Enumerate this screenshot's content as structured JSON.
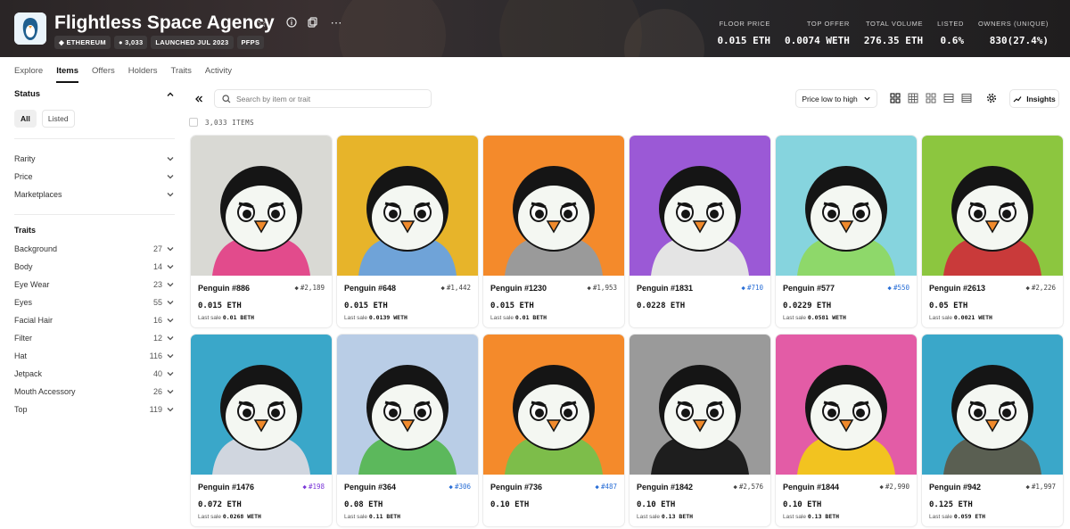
{
  "header": {
    "title": "Flightless Space Agency",
    "chips": [
      "◆ ETHEREUM",
      "● 3,033",
      "LAUNCHED JUL 2023",
      "PFPS"
    ],
    "stats": [
      {
        "label": "FLOOR PRICE",
        "value": "0.015 ETH"
      },
      {
        "label": "TOP OFFER",
        "value": "0.0074 WETH"
      },
      {
        "label": "TOTAL VOLUME",
        "value": "276.35 ETH"
      },
      {
        "label": "LISTED",
        "value": "0.6%"
      },
      {
        "label": "OWNERS (UNIQUE)",
        "value": "830(27.4%)"
      }
    ]
  },
  "tabs": [
    "Explore",
    "Items",
    "Offers",
    "Holders",
    "Traits",
    "Activity"
  ],
  "active_tab": "Items",
  "sidebar": {
    "status_label": "Status",
    "status_options": [
      "All",
      "Listed"
    ],
    "filters": [
      "Rarity",
      "Price",
      "Marketplaces"
    ],
    "traits_label": "Traits",
    "traits": [
      {
        "name": "Background",
        "count": "27"
      },
      {
        "name": "Body",
        "count": "14"
      },
      {
        "name": "Eye Wear",
        "count": "23"
      },
      {
        "name": "Eyes",
        "count": "55"
      },
      {
        "name": "Facial Hair",
        "count": "16"
      },
      {
        "name": "Filter",
        "count": "12"
      },
      {
        "name": "Hat",
        "count": "116"
      },
      {
        "name": "Jetpack",
        "count": "40"
      },
      {
        "name": "Mouth Accessory",
        "count": "26"
      },
      {
        "name": "Top",
        "count": "119"
      }
    ]
  },
  "toolbar": {
    "search_placeholder": "Search by item or trait",
    "sort_label": "Price low to high",
    "insights_label": "Insights"
  },
  "items_count": "3,033 ITEMS",
  "items": [
    {
      "name": "Penguin #886",
      "rank": "#2,189",
      "rank_tier": "gray",
      "price": "0.015 ETH",
      "last_label": "Last sale",
      "last_value": "0.01 BETH",
      "bg": "#d9d9d4",
      "outfit": "#e24b8c"
    },
    {
      "name": "Penguin #648",
      "rank": "#1,442",
      "rank_tier": "gray",
      "price": "0.015 ETH",
      "last_label": "Last sale",
      "last_value": "0.0139 WETH",
      "bg": "#e7b42a",
      "outfit": "#6fa3d8"
    },
    {
      "name": "Penguin #1230",
      "rank": "#1,953",
      "rank_tier": "gray",
      "price": "0.015 ETH",
      "last_label": "Last sale",
      "last_value": "0.01 BETH",
      "bg": "#f48a2b",
      "outfit": "#9a9a9a"
    },
    {
      "name": "Penguin #1831",
      "rank": "#710",
      "rank_tier": "blue",
      "price": "0.0228 ETH",
      "last_label": "",
      "last_value": "",
      "bg": "#9b59d6",
      "outfit": "#e4e4e4"
    },
    {
      "name": "Penguin #577",
      "rank": "#550",
      "rank_tier": "blue",
      "price": "0.0229 ETH",
      "last_label": "Last sale",
      "last_value": "0.0581 WETH",
      "bg": "#86d4de",
      "outfit": "#8ed86a"
    },
    {
      "name": "Penguin #2613",
      "rank": "#2,226",
      "rank_tier": "gray",
      "price": "0.05 ETH",
      "last_label": "Last sale",
      "last_value": "0.0021 WETH",
      "bg": "#8cc63f",
      "outfit": "#c93a3a"
    },
    {
      "name": "Penguin #1476",
      "rank": "#198",
      "rank_tier": "purple",
      "price": "0.072 ETH",
      "last_label": "Last sale",
      "last_value": "0.0268 WETH",
      "bg": "#3aa7c9",
      "outfit": "#d0d6df"
    },
    {
      "name": "Penguin #364",
      "rank": "#306",
      "rank_tier": "blue",
      "price": "0.08 ETH",
      "last_label": "Last sale",
      "last_value": "0.11 BETH",
      "bg": "#b9cde6",
      "outfit": "#5cb85c"
    },
    {
      "name": "Penguin #736",
      "rank": "#487",
      "rank_tier": "blue",
      "price": "0.10 ETH",
      "last_label": "",
      "last_value": "",
      "bg": "#f48a2b",
      "outfit": "#7dbd4a"
    },
    {
      "name": "Penguin #1842",
      "rank": "#2,576",
      "rank_tier": "gray",
      "price": "0.10 ETH",
      "last_label": "Last sale",
      "last_value": "0.13 BETH",
      "bg": "#9a9a9a",
      "outfit": "#1e1e1e"
    },
    {
      "name": "Penguin #1844",
      "rank": "#2,990",
      "rank_tier": "gray",
      "price": "0.10 ETH",
      "last_label": "Last sale",
      "last_value": "0.13 BETH",
      "bg": "#e35ca6",
      "outfit": "#f2c320"
    },
    {
      "name": "Penguin #942",
      "rank": "#1,997",
      "rank_tier": "gray",
      "price": "0.125 ETH",
      "last_label": "Last sale",
      "last_value": "0.059 ETH",
      "bg": "#3aa7c9",
      "outfit": "#5a5f52"
    }
  ]
}
